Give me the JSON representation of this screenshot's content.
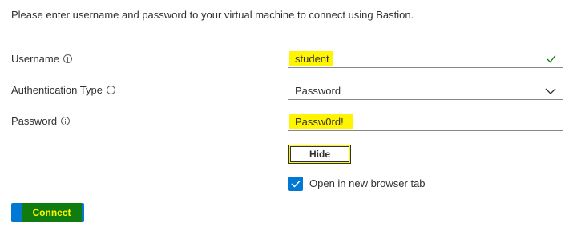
{
  "intro_text": "Please enter username and password to your virtual machine to connect using Bastion.",
  "username": {
    "label": "Username",
    "value": "student"
  },
  "auth_type": {
    "label": "Authentication Type",
    "value": "Password"
  },
  "password": {
    "label": "Password",
    "value": "Passw0rd!"
  },
  "hide_button_label": "Hide",
  "open_new_tab": {
    "label": "Open in new browser tab",
    "checked": true
  },
  "connect_button_label": "Connect",
  "colors": {
    "highlight": "#fff500",
    "accent": "#0078d4",
    "valid_check": "#107c10",
    "connect_highlight": "#107c10"
  },
  "icons": {
    "info": "info-icon",
    "valid": "checkmark-icon",
    "dropdown": "chevron-down-icon",
    "checkbox": "checkbox-checked-icon"
  }
}
